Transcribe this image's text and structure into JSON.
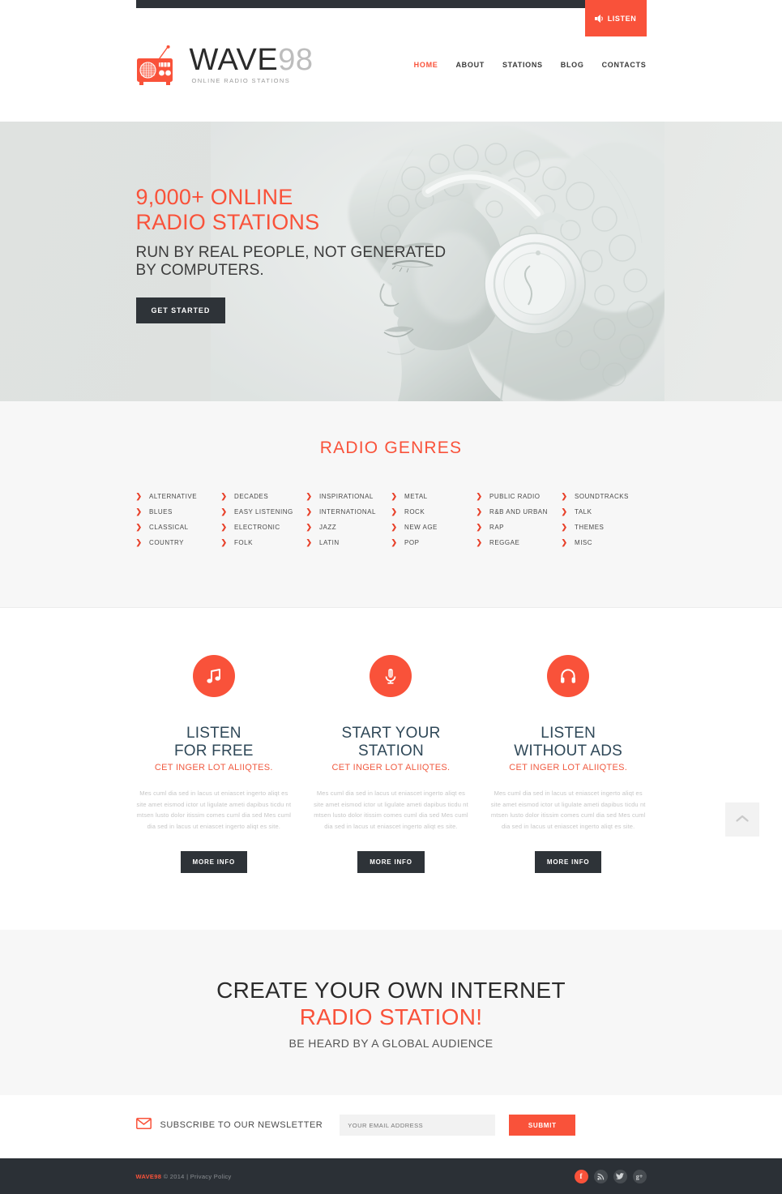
{
  "topbar": {
    "listen_label": "LISTEN",
    "listen_icon": "speaker-icon"
  },
  "brand": {
    "logo_icon": "radio-icon",
    "name_main": "WAVE",
    "name_number": "98",
    "tagline": "ONLINE RADIO STATIONS"
  },
  "nav": {
    "items": [
      {
        "label": "HOME",
        "active": true
      },
      {
        "label": "ABOUT",
        "active": false
      },
      {
        "label": "STATIONS",
        "active": false
      },
      {
        "label": "BLOG",
        "active": false
      },
      {
        "label": "CONTACTS",
        "active": false
      }
    ]
  },
  "hero": {
    "headline_line1": "9,000+ ONLINE",
    "headline_line2": "RADIO STATIONS",
    "subhead_line1": "RUN BY REAL PEOPLE, NOT GENERATED",
    "subhead_line2": "BY COMPUTERS.",
    "cta_label": "GET STARTED",
    "image_alt": "woman-with-headphones-photo"
  },
  "genres": {
    "title": "RADIO GENRES",
    "columns": [
      [
        "ALTERNATIVE",
        "BLUES",
        "CLASSICAL",
        "COUNTRY"
      ],
      [
        "DECADES",
        "EASY LISTENING",
        "ELECTRONIC",
        "FOLK"
      ],
      [
        "INSPIRATIONAL",
        "INTERNATIONAL",
        "JAZZ",
        "LATIN"
      ],
      [
        "METAL",
        "ROCK",
        "NEW AGE",
        "POP"
      ],
      [
        "PUBLIC RADIO",
        "R&B AND URBAN",
        "RAP",
        "REGGAE"
      ],
      [
        "SOUNDTRACKS",
        "TALK",
        "THEMES",
        "MISC"
      ]
    ],
    "bullet_icon": "chevron-right-icon"
  },
  "features": {
    "body_text": "Mes cuml dia sed in lacus ut eniascet ingerto aliqt es site amet eismod ictor ut ligulate ameti dapibus ticdu nt mtsen lusto dolor itissim comes cuml dia sed Mes cuml dia sed in lacus ut eniascet ingerto aliqt es site.",
    "more_label": "MORE INFO",
    "items": [
      {
        "icon": "music-note-icon",
        "title_line1": "LISTEN",
        "title_line2": "FOR FREE",
        "subtitle": "CET INGER LOT ALIIQTES."
      },
      {
        "icon": "microphone-icon",
        "title_line1": "START YOUR",
        "title_line2": "STATION",
        "subtitle": "CET INGER LOT ALIIQTES."
      },
      {
        "icon": "headphones-icon",
        "title_line1": "LISTEN",
        "title_line2": "WITHOUT ADS",
        "subtitle": "CET INGER LOT ALIIQTES."
      }
    ],
    "scroll_top_icon": "chevron-up-icon"
  },
  "cta": {
    "line1": "CREATE YOUR OWN INTERNET",
    "line2": "RADIO STATION!",
    "line3": "BE HEARD BY A GLOBAL AUDIENCE"
  },
  "newsletter": {
    "icon": "envelope-icon",
    "label": "SUBSCRIBE TO OUR NEWSLETTER",
    "input_value": "",
    "input_placeholder": "YOUR EMAIL ADDRESS",
    "submit_label": "SUBMIT"
  },
  "footer": {
    "brand": "WAVE98",
    "copyright": "© 2014",
    "separator": "|",
    "privacy_label": "Privacy Policy",
    "socials": [
      {
        "name": "facebook",
        "glyph": "f"
      },
      {
        "name": "rss",
        "glyph": ""
      },
      {
        "name": "twitter",
        "glyph": ""
      },
      {
        "name": "google-plus",
        "glyph": "g+"
      }
    ]
  },
  "colors": {
    "accent": "#f9523a",
    "dark": "#2e3338",
    "footer_bg": "#2b3036",
    "heading_slate": "#2f4858",
    "section_bg": "#f7f7f7"
  }
}
